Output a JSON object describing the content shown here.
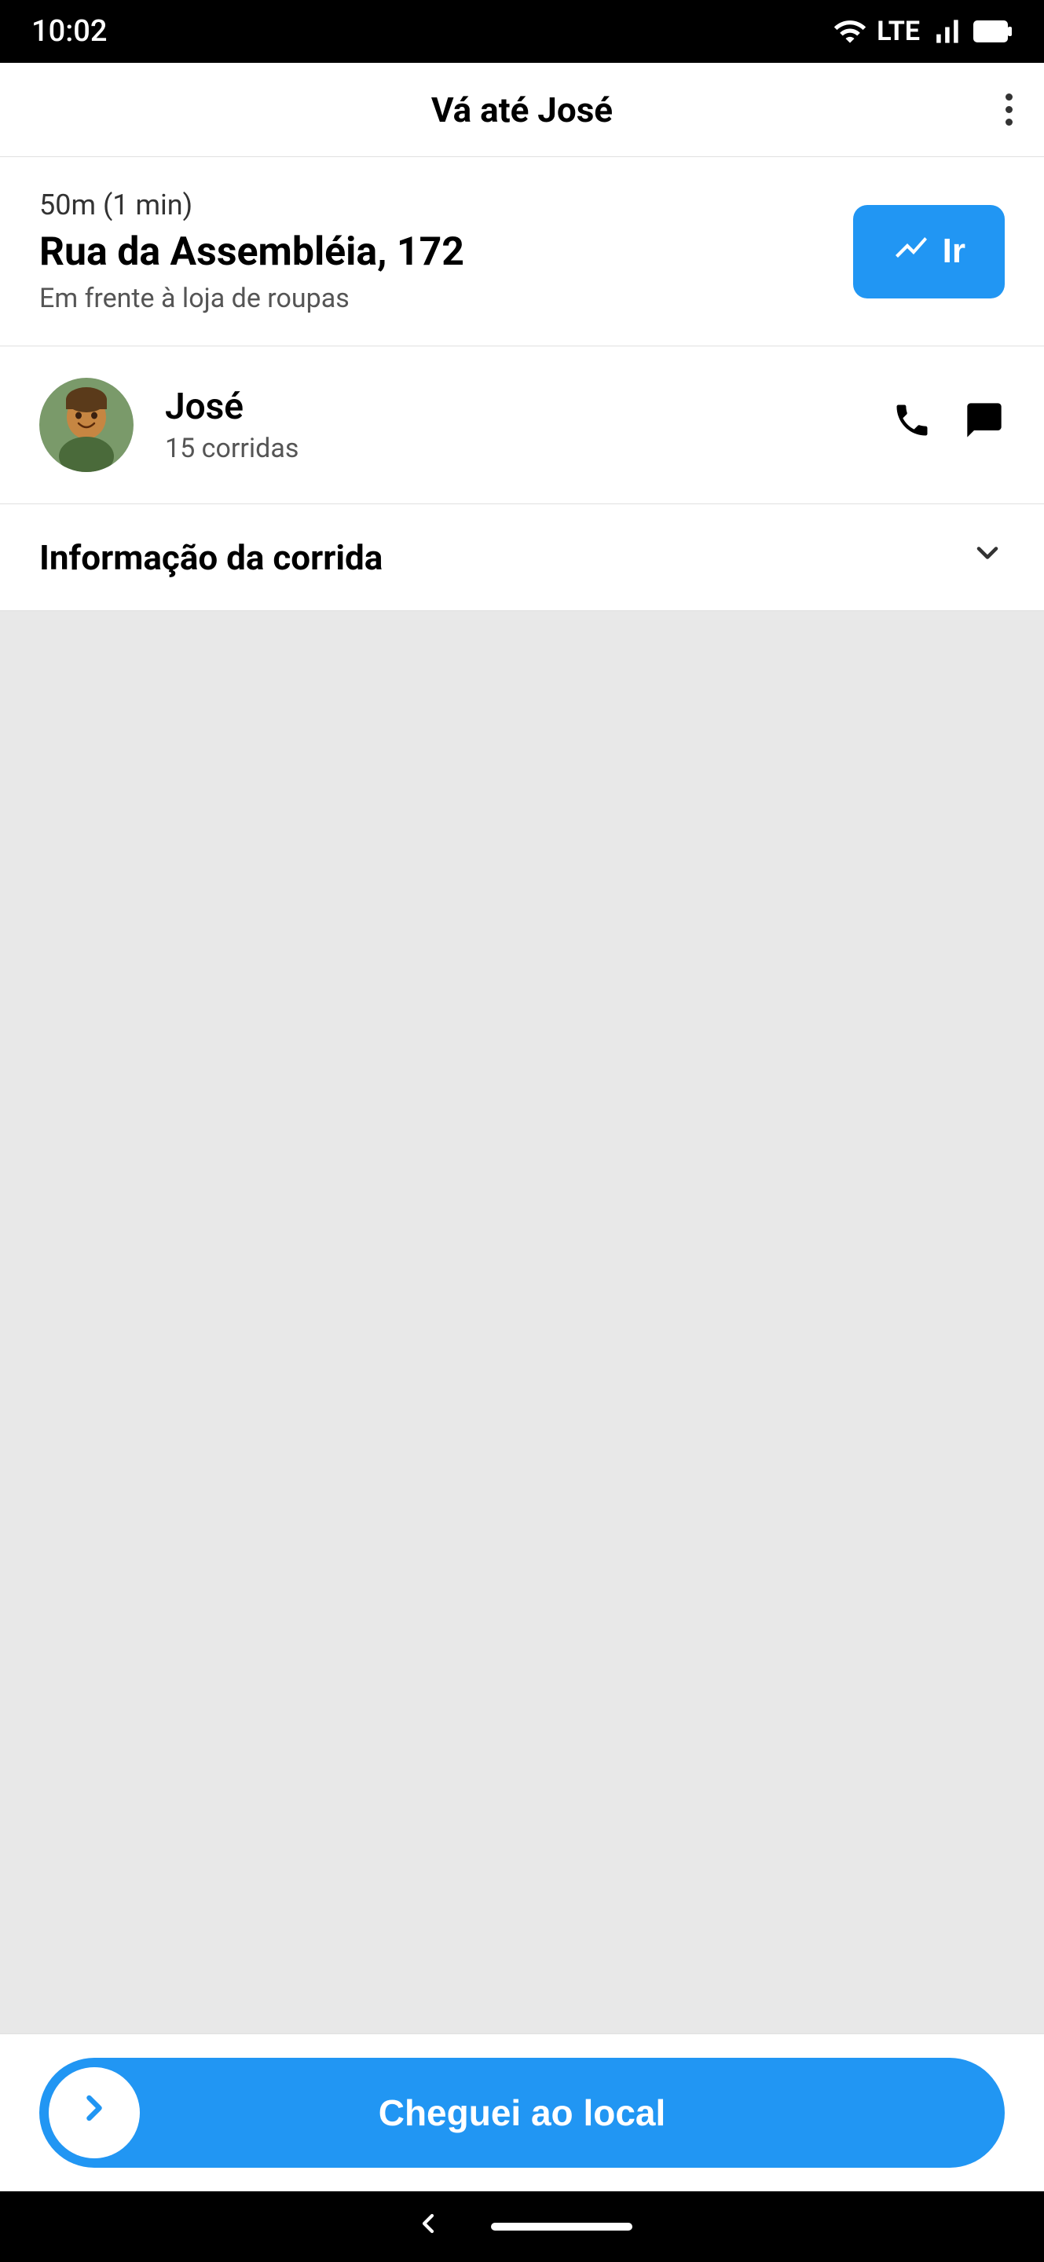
{
  "statusBar": {
    "time": "10:02",
    "wifi": "▼",
    "lte": "LTE",
    "signal": "▲",
    "battery": "🔋"
  },
  "appBar": {
    "title": "Vá até José",
    "menuIcon": "more-vertical"
  },
  "address": {
    "distance": "50m (1 min)",
    "street": "Rua da Assembléia, 172",
    "hint": "Em frente à loja de roupas",
    "goButton": "Ir"
  },
  "rider": {
    "name": "José",
    "rides": "15 corridas",
    "phoneIcon": "phone",
    "chatIcon": "chat"
  },
  "rideInfo": {
    "label": "Informação da corrida",
    "chevronIcon": "chevron-down"
  },
  "cta": {
    "label": "Cheguei ao local",
    "arrowIcon": "chevron-right"
  },
  "navBar": {
    "backIcon": "back-arrow",
    "homeIndicator": "home-pill"
  }
}
